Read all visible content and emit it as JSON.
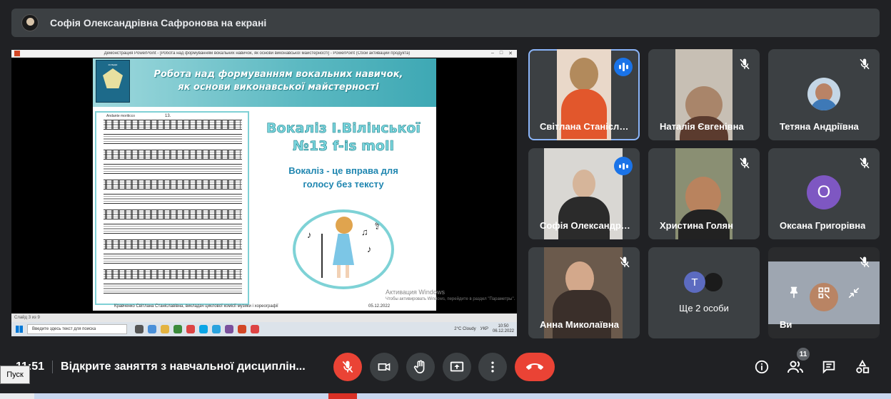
{
  "banner": {
    "title": "Софія Олександрівна Сафронова на екрані"
  },
  "shared_screen": {
    "window_caption": "Демонстрация PowerPoint - [Робота над формуванням вокальних навичок, як основи виконавської майстерності] - PowerPoint (Сбой активации продукта)",
    "slide": {
      "title_line1": "Робота над формуванням вокальних навичок,",
      "title_line2": "як основи виконавської майстерності",
      "heading_line1": "Вокаліз І.Вілінської",
      "heading_line2": "№13 f-is moll",
      "sub_line1": "Вокаліз - це вправа для",
      "sub_line2": "голосу без тексту",
      "footer_author": "Кравченко Світлана Станіславівна, викладач циклової комісії музики і хореографії",
      "footer_date": "05.12.2022",
      "score_tempo": "Andante moriticco",
      "score_number": "13."
    },
    "activation": {
      "title": "Активация Windows",
      "hint": "Чтобы активировать Windows, перейдите в раздел \"Параметры\"."
    },
    "status_bar": "Слайд 3 из 9",
    "taskbar": {
      "search_placeholder": "Введите здесь текст для поиска",
      "weather": "2°C Cloudy",
      "lang": "УКР",
      "time": "10:50",
      "date": "06.12.2022"
    }
  },
  "participants": [
    {
      "name": "Світлана Станіславівна Кравченко",
      "state": "speaking"
    },
    {
      "name": "Наталія Євгенівна",
      "state": "muted"
    },
    {
      "name": "Тетяна Андріївна",
      "state": "muted"
    },
    {
      "name": "Софія Олександрівна",
      "state": "speaking"
    },
    {
      "name": "Христина Голян",
      "state": "muted"
    },
    {
      "name": "Оксана Григорівна",
      "state": "muted",
      "avatar_letter": "О"
    },
    {
      "name": "Анна Миколаївна",
      "state": "muted"
    },
    {
      "name": "Ще 2 особи",
      "avatar_letter": "Т"
    },
    {
      "name": "Ви",
      "state": "muted"
    }
  ],
  "bottom": {
    "time": "11:51",
    "meeting_title": "Відкрите заняття з навчальної дисциплін...",
    "people_count": "11"
  },
  "tooltip": "Пуск",
  "colors": {
    "accent": "#8ab4f8",
    "danger": "#ea4335",
    "speaking": "#1a73e8",
    "avatar": "#7e57c2"
  }
}
